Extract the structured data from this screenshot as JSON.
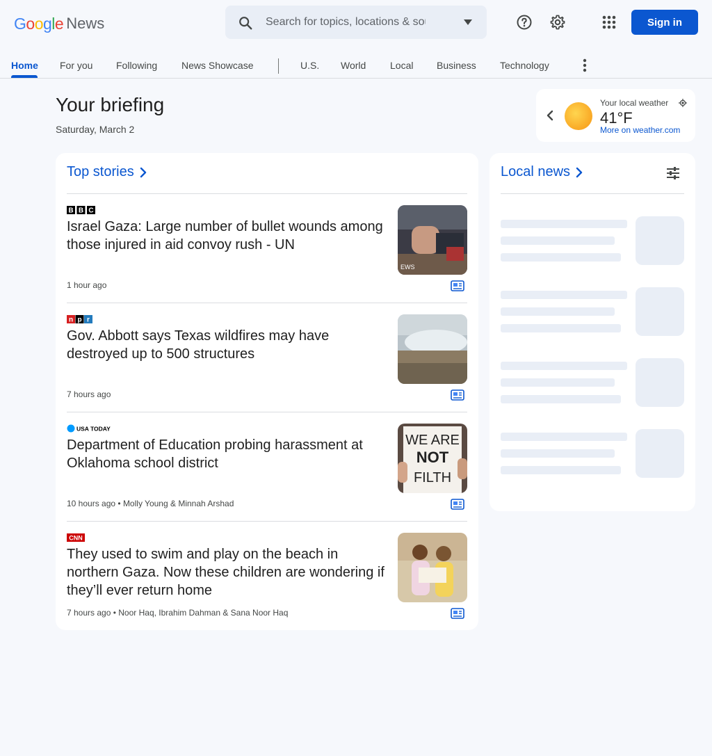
{
  "header": {
    "logo_google": "Google",
    "logo_news": "News",
    "search_placeholder": "Search for topics, locations & sources",
    "signin_label": "Sign in"
  },
  "tabs": [
    {
      "label": "Home",
      "active": true
    },
    {
      "label": "For you"
    },
    {
      "label": "Following"
    },
    {
      "label": "News Showcase"
    },
    {
      "label": "U.S."
    },
    {
      "label": "World"
    },
    {
      "label": "Local"
    },
    {
      "label": "Business"
    },
    {
      "label": "Technology"
    }
  ],
  "briefing": {
    "title": "Your briefing",
    "date": "Saturday, March 2"
  },
  "weather": {
    "label": "Your local weather",
    "temp": "41°F",
    "link": "More on weather.com",
    "icon": "sun-icon"
  },
  "top_stories": {
    "title": "Top stories",
    "stories": [
      {
        "source": "BBC",
        "headline": "Israel Gaza: Large number of bullet wounds among those injured in aid convoy rush - UN",
        "time": "1 hour ago",
        "authors": ""
      },
      {
        "source": "npr",
        "headline": "Gov. Abbott says Texas wildfires may have destroyed up to 500 structures",
        "time": "7 hours ago",
        "authors": ""
      },
      {
        "source": "USA TODAY",
        "headline": "Department of Education probing harassment at Oklahoma school district",
        "time": "10 hours ago",
        "authors": "Molly Young & Minnah Arshad"
      },
      {
        "source": "CNN",
        "headline": "They used to swim and play on the beach in northern Gaza. Now these children are wondering if they’ll ever return home",
        "time": "7 hours ago",
        "authors": "Noor Haq, Ibrahim Dahman & Sana Noor Haq"
      }
    ]
  },
  "local_news": {
    "title": "Local news"
  },
  "colors": {
    "accent": "#0b57d0",
    "background": "#f6f8fc",
    "card": "#ffffff",
    "skeleton": "#e9eef6"
  }
}
